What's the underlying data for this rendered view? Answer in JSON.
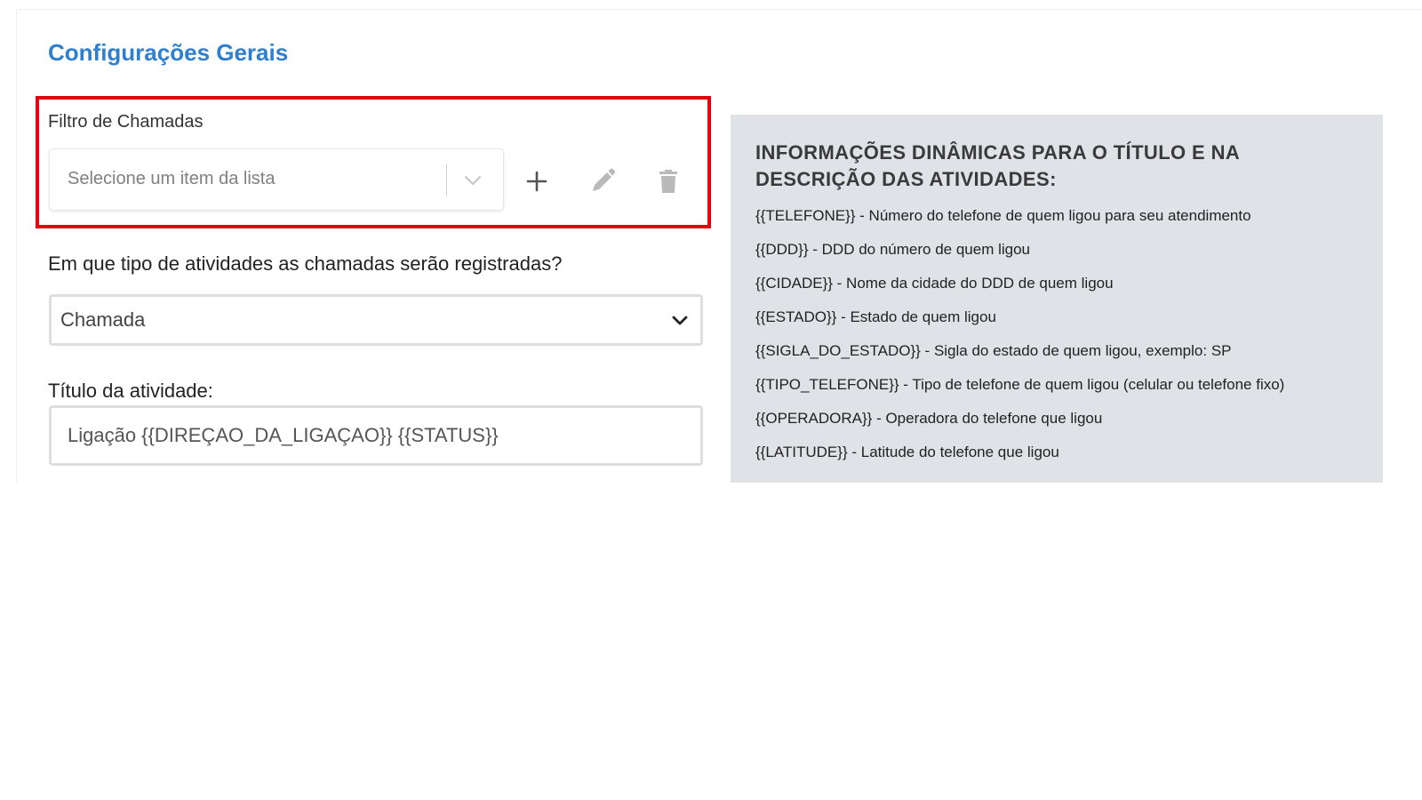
{
  "section": {
    "title": "Configurações Gerais"
  },
  "colors": {
    "accent": "#2f7fd0",
    "highlight": "#e4000f",
    "panel_bg": "#dfe2e6"
  },
  "call_filter": {
    "label": "Filtro de Chamadas",
    "placeholder": "Selecione um item da lista",
    "icons": [
      "chevron-down-icon",
      "plus-icon",
      "pencil-icon",
      "trash-icon"
    ]
  },
  "activity_type": {
    "question": "Em que tipo de atividades as chamadas serão registradas?",
    "selected": "Chamada"
  },
  "activity_title": {
    "label": "Título da atividade:",
    "value": "Ligação {{DIREÇAO_DA_LIGAÇAO}} {{STATUS}}"
  },
  "info": {
    "title": "INFORMAÇÕES DINÂMICAS PARA O TÍTULO E NA DESCRIÇÃO DAS ATIVIDADES:",
    "items": [
      "{{TELEFONE}} - Número do telefone de quem ligou para seu atendimento",
      "{{DDD}} - DDD do número de quem ligou",
      "{{CIDADE}} - Nome da cidade do DDD de quem ligou",
      "{{ESTADO}} - Estado de quem ligou",
      "{{SIGLA_DO_ESTADO}} - Sigla do estado de quem ligou, exemplo: SP",
      "{{TIPO_TELEFONE}} - Tipo de telefone de quem ligou (celular ou telefone fixo)",
      "{{OPERADORA}} - Operadora do telefone que ligou",
      "{{LATITUDE}} - Latitude do telefone que ligou"
    ]
  }
}
